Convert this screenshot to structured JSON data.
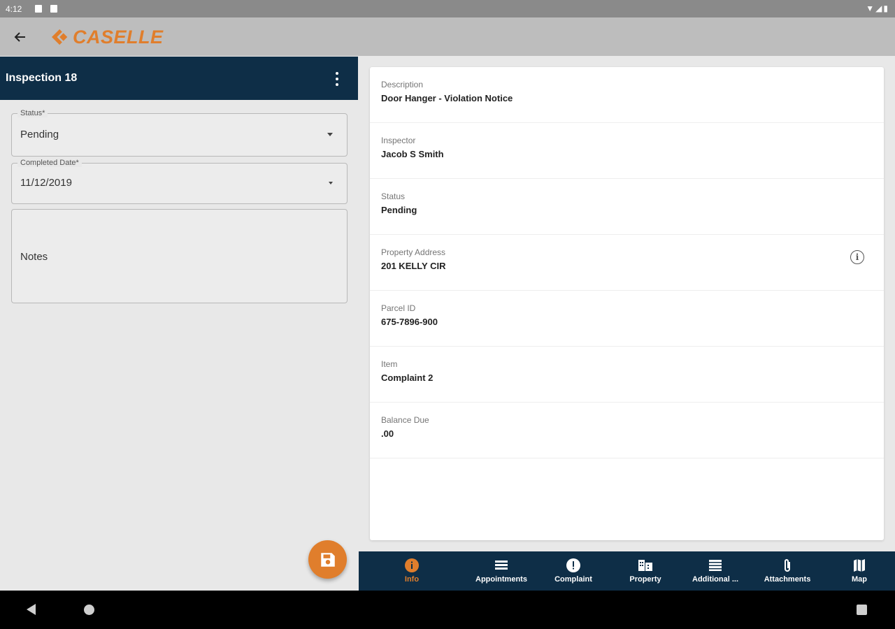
{
  "status_bar": {
    "time": "4:12",
    "right_icons": "▼◢▮"
  },
  "app": {
    "logo_text": "CASELLE",
    "brand_color": "#e07e2c",
    "header_color": "#0e2e47"
  },
  "left": {
    "title": "Inspection 18",
    "status_field": {
      "label": "Status*",
      "value": "Pending"
    },
    "date_field": {
      "label": "Completed Date*",
      "value": "11/12/2019"
    },
    "notes_field": {
      "placeholder": "Notes"
    }
  },
  "details": {
    "rows": [
      {
        "label": "Description",
        "value": "Door Hanger - Violation Notice"
      },
      {
        "label": "Inspector",
        "value": "Jacob S Smith"
      },
      {
        "label": "Status",
        "value": "Pending"
      },
      {
        "label": "Property Address",
        "value": "201 KELLY CIR"
      },
      {
        "label": "Parcel ID",
        "value": "675-7896-900"
      },
      {
        "label": "Item",
        "value": "Complaint 2"
      },
      {
        "label": "Balance Due",
        "value": ".00"
      }
    ]
  },
  "bottom_nav": {
    "items": [
      {
        "label": "Info",
        "icon": "info-icon",
        "active": true
      },
      {
        "label": "Appointments",
        "icon": "list-icon"
      },
      {
        "label": "Complaint",
        "icon": "alert-icon"
      },
      {
        "label": "Property",
        "icon": "building-icon"
      },
      {
        "label": "Additional ...",
        "icon": "list-icon"
      },
      {
        "label": "Attachments",
        "icon": "paperclip-icon"
      },
      {
        "label": "Map",
        "icon": "map-icon"
      }
    ]
  }
}
